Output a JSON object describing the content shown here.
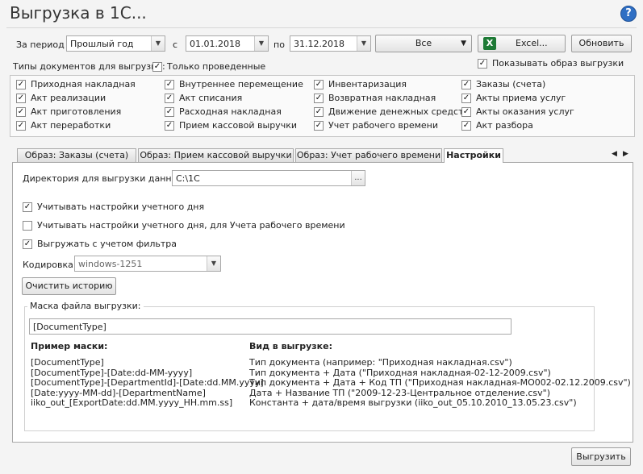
{
  "window": {
    "title": "Выгрузка в 1С..."
  },
  "toolbar": {
    "period_label": "За период",
    "period_value": "Прошлый год",
    "from_label": "с",
    "from_date": "01.01.2018",
    "to_label": "по",
    "to_date": "31.12.2018",
    "all_dropdown": "Все",
    "excel_button": "Excel...",
    "refresh_button": "Обновить"
  },
  "doc_types": {
    "label": "Типы документов для выгрузки:",
    "only_posted": "Только проведенные",
    "show_preview": "Показывать образ выгрузки",
    "columns": [
      [
        "Приходная накладная",
        "Акт реализации",
        "Акт приготовления",
        "Акт переработки"
      ],
      [
        "Внутреннее перемещение",
        "Акт списания",
        "Расходная накладная",
        "Прием кассовой выручки"
      ],
      [
        "Инвентаризация",
        "Возвратная накладная",
        "Движение денежных средств",
        "Учет рабочего времени"
      ],
      [
        "Заказы (счета)",
        "Акты приема услуг",
        "Акты оказания услуг",
        "Акт разбора"
      ]
    ]
  },
  "tabs": [
    "Образ: Заказы (счета)",
    "Образ: Прием кассовой выручки",
    "Образ: Учет рабочего времени",
    "Настройки"
  ],
  "settings": {
    "dir_label": "Директория для выгрузки данных:",
    "dir_value": "C:\\1C",
    "dir_browse": "...",
    "opt1": "Учитывать настройки учетного дня",
    "opt2": "Учитывать настройки учетного дня, для Учета рабочего времени",
    "opt3": "Выгружать с учетом фильтра",
    "encoding_label": "Кодировка:",
    "encoding_value": "windows-1251",
    "clear_history": "Очистить историю",
    "mask_group_label": "Маска файла выгрузки:",
    "mask_value": "[DocumentType]",
    "example_header": "Пример маски:",
    "view_header": "Вид в выгрузке:",
    "examples": [
      "[DocumentType]",
      "[DocumentType]-[Date:dd-MM-yyyy]",
      "[DocumentType]-[DepartmentId]-[Date:dd.MM.yyyy]",
      "[Date:yyyy-MM-dd]-[DepartmentName]",
      "iiko_out_[ExportDate:dd.MM.yyyy_HH.mm.ss]"
    ],
    "views": [
      "Тип документа (например: \"Приходная накладная.csv\")",
      "Тип документа + Дата (\"Приходная накладная-02-12-2009.csv\")",
      "Тип документа + Дата + Код ТП (\"Приходная накладная-MO002-02.12.2009.csv\")",
      "Дата + Название ТП (\"2009-12-23-Центральное отделение.csv\")",
      "Константа + дата/время выгрузки (iiko_out_05.10.2010_13.05.23.csv\")"
    ]
  },
  "footer": {
    "export_button": "Выгрузить"
  }
}
